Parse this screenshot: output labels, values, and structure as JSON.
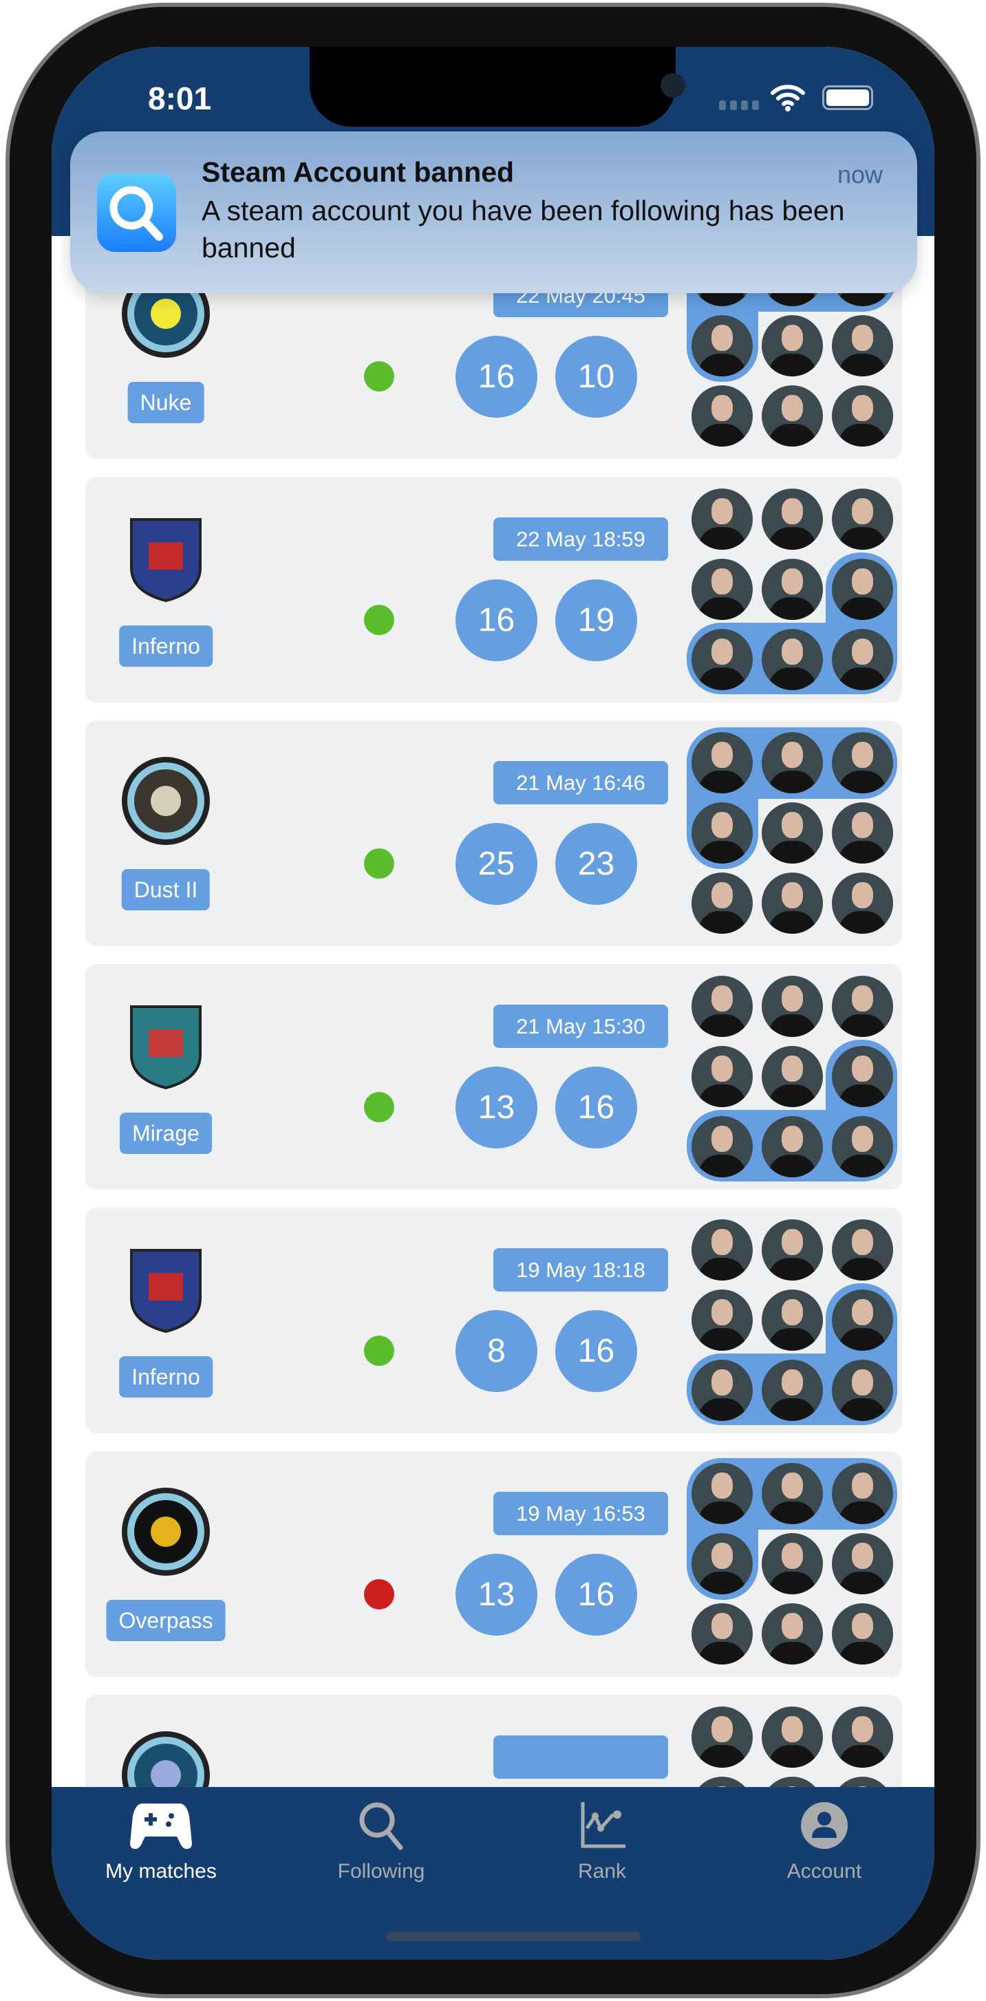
{
  "status": {
    "time": "8:01"
  },
  "notification": {
    "title": "Steam Account banned",
    "body": "A steam account you have been following has been banned",
    "time": "now",
    "icon": "search-icon"
  },
  "colors": {
    "header": "#143d70",
    "accent": "#659fe1",
    "win": "#5bbd2b",
    "loss": "#cc1f1f",
    "card": "#eff0f2"
  },
  "matches": [
    {
      "map": "Nuke",
      "date": "22 May 20:45",
      "score": [
        "16",
        "10"
      ],
      "result": "win",
      "team_slots": [
        0,
        1,
        2,
        3
      ]
    },
    {
      "map": "Inferno",
      "date": "22 May 18:59",
      "score": [
        "16",
        "19"
      ],
      "result": "win",
      "team_slots": [
        5,
        6,
        7,
        8
      ]
    },
    {
      "map": "Dust II",
      "date": "21 May 16:46",
      "score": [
        "25",
        "23"
      ],
      "result": "win",
      "team_slots": [
        0,
        1,
        2,
        3
      ]
    },
    {
      "map": "Mirage",
      "date": "21 May 15:30",
      "score": [
        "13",
        "16"
      ],
      "result": "win",
      "team_slots": [
        5,
        6,
        7,
        8
      ]
    },
    {
      "map": "Inferno",
      "date": "19 May 18:18",
      "score": [
        "8",
        "16"
      ],
      "result": "win",
      "team_slots": [
        5,
        6,
        7,
        8
      ]
    },
    {
      "map": "Overpass",
      "date": "19 May 16:53",
      "score": [
        "13",
        "16"
      ],
      "result": "loss",
      "team_slots": [
        0,
        1,
        2,
        3
      ]
    },
    {
      "map": "",
      "date": "",
      "score": [
        "",
        ""
      ],
      "result": "",
      "team_slots": []
    }
  ],
  "tabs": [
    {
      "label": "My matches",
      "icon": "gamepad-icon",
      "active": true
    },
    {
      "label": "Following",
      "icon": "search-icon",
      "active": false
    },
    {
      "label": "Rank",
      "icon": "chart-icon",
      "active": false
    },
    {
      "label": "Account",
      "icon": "account-icon",
      "active": false
    }
  ]
}
